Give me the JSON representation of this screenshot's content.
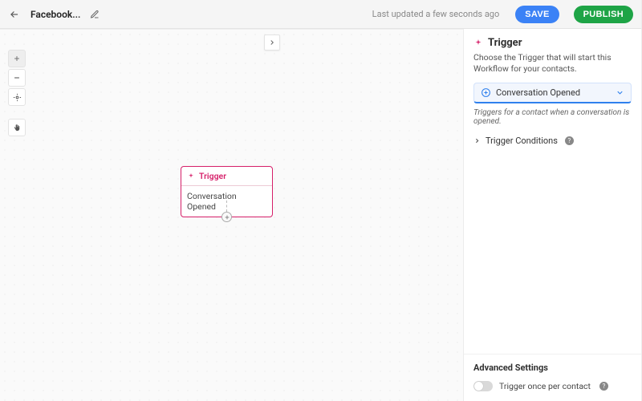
{
  "topbar": {
    "title": "Facebook...",
    "updated": "Last updated a few seconds ago",
    "save": "SAVE",
    "publish": "PUBLISH"
  },
  "canvas": {
    "node_header": "Trigger",
    "node_body": "Conversation Opened"
  },
  "panel": {
    "title": "Trigger",
    "subtitle": "Choose the Trigger that will start this Workflow for your contacts.",
    "select_label": "Conversation Opened",
    "help_text": "Triggers for a contact when a conversation is opened.",
    "conditions_label": "Trigger Conditions",
    "advanced_heading": "Advanced Settings",
    "once_label": "Trigger once per contact"
  }
}
